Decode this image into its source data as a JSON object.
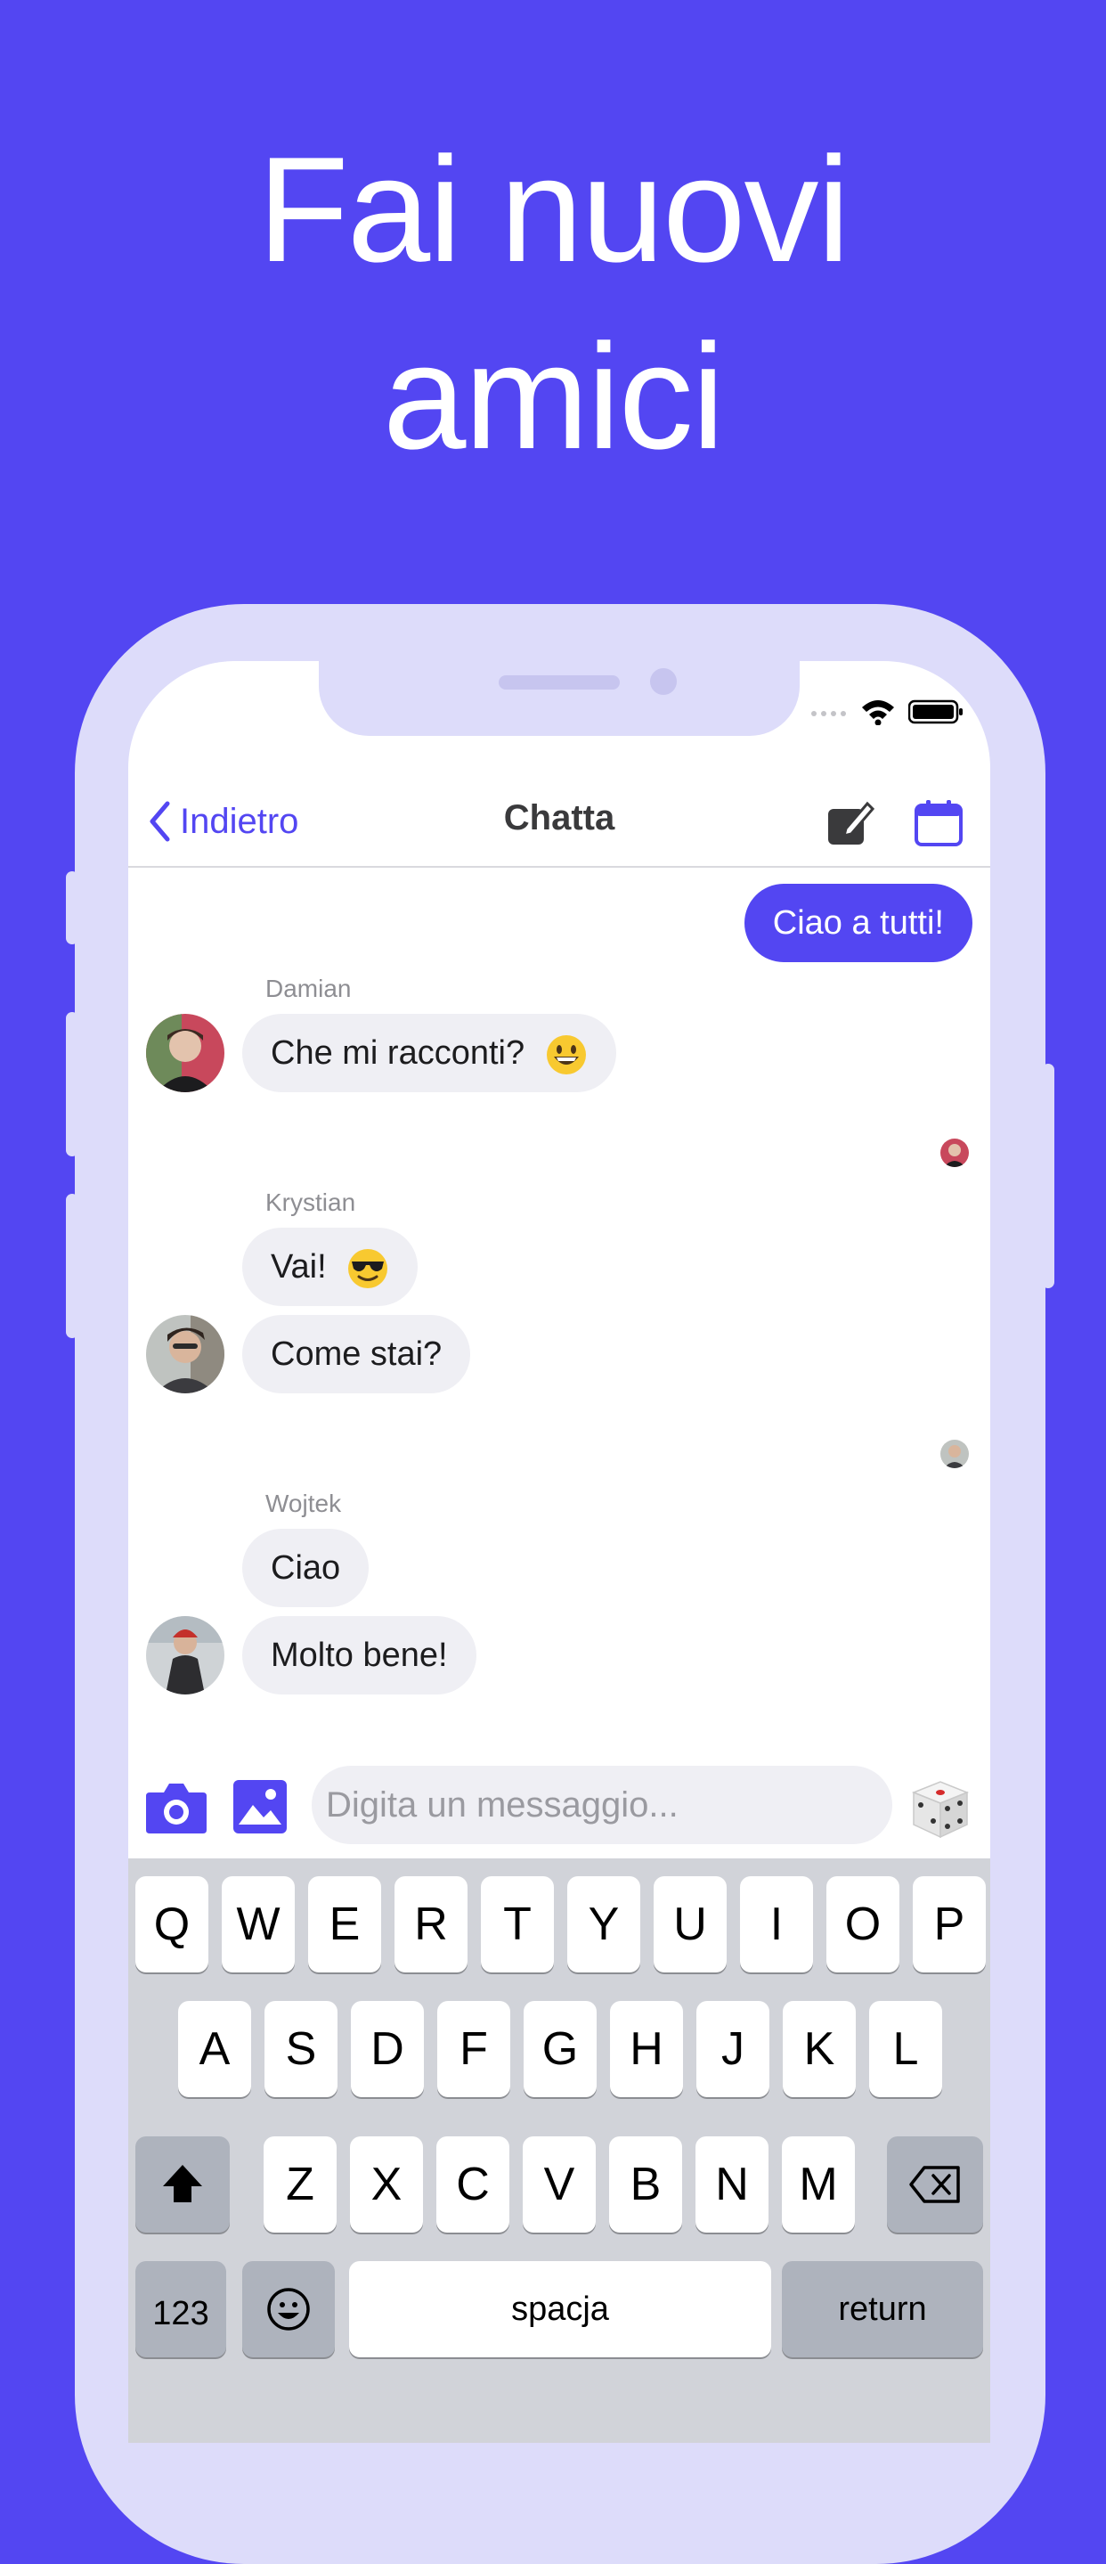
{
  "headline": {
    "line1": "Fai nuovi",
    "line2": "amici"
  },
  "navbar": {
    "back_label": "Indietro",
    "title": "Chatta",
    "icons": [
      "edit-icon",
      "calendar-icon"
    ]
  },
  "chat": {
    "outgoing": {
      "text": "Ciao a tutti!"
    },
    "groups": [
      {
        "sender": "Damian",
        "messages": [
          "Che mi racconti?"
        ],
        "emoji": "grinning-face"
      },
      {
        "sender": "Krystian",
        "messages": [
          "Vai!",
          "Come stai?"
        ],
        "emoji": "sunglasses-face"
      },
      {
        "sender": "Wojtek",
        "messages": [
          "Ciao",
          "Molto bene!"
        ]
      }
    ]
  },
  "input": {
    "placeholder": "Digita un messaggio...",
    "icons": [
      "camera-icon",
      "image-icon",
      "dice-icon"
    ]
  },
  "keyboard": {
    "row1": [
      "Q",
      "W",
      "E",
      "R",
      "T",
      "Y",
      "U",
      "I",
      "O",
      "P"
    ],
    "row2": [
      "A",
      "S",
      "D",
      "F",
      "G",
      "H",
      "J",
      "K",
      "L"
    ],
    "row3": [
      "Z",
      "X",
      "C",
      "V",
      "B",
      "N",
      "M"
    ],
    "numbers_label": "123",
    "space_label": "spacja",
    "return_label": "return"
  },
  "colors": {
    "background": "#5346f2",
    "accent": "#5346f2",
    "phone_frame": "#dddcfa",
    "bubble_incoming": "#efeff4"
  }
}
